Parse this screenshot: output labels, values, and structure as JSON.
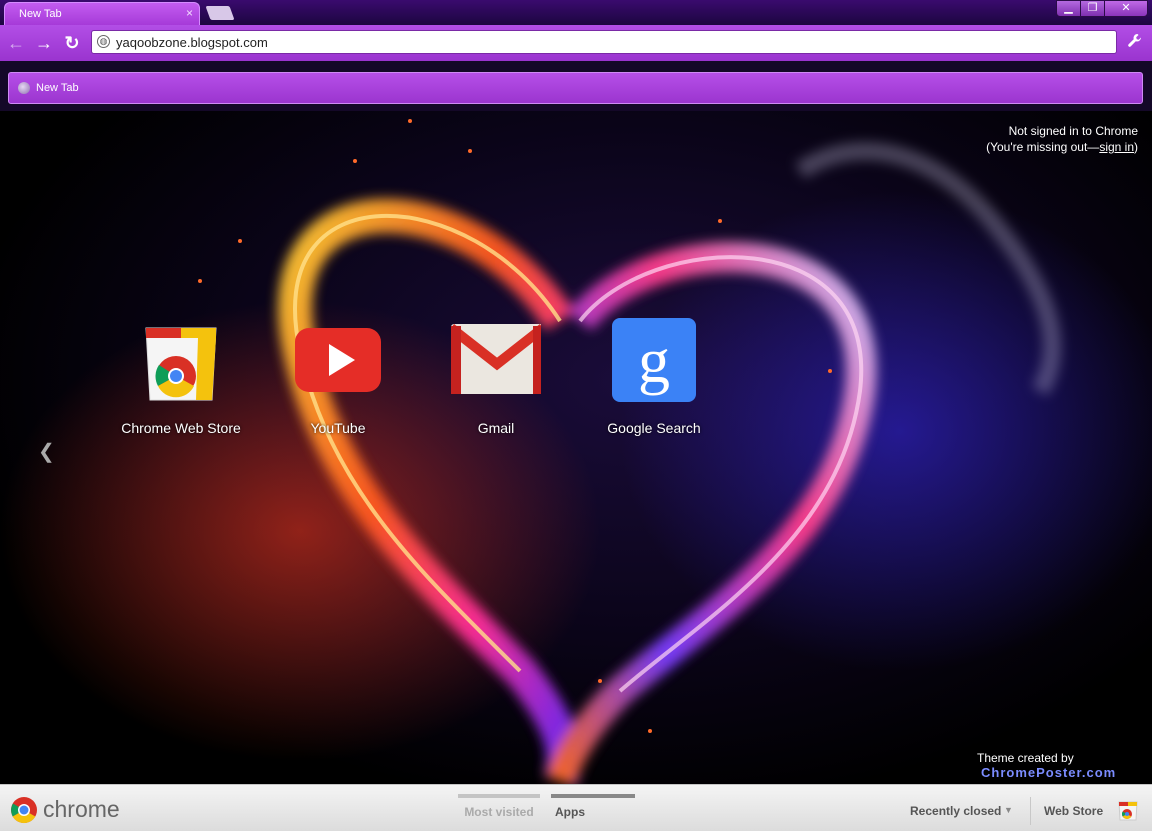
{
  "tabs": [
    {
      "title": "New Tab",
      "close_glyph": "×"
    }
  ],
  "window_controls": {
    "minimize": "▁",
    "maximize": "❐",
    "close": "✕"
  },
  "toolbar": {
    "back_glyph": "←",
    "forward_glyph": "→",
    "reload_glyph": "↻",
    "url": "yaqoobzone.blogspot.com",
    "wrench_glyph": "🔧"
  },
  "page_bar": {
    "title": "New Tab"
  },
  "signin": {
    "line1": "Not signed in to Chrome",
    "line2_prefix": "(You're missing out—",
    "link": "sign in",
    "line2_suffix": ")"
  },
  "apps": [
    {
      "label": "Chrome Web Store",
      "icon": "chrome-web-store-icon"
    },
    {
      "label": "YouTube",
      "icon": "youtube-icon"
    },
    {
      "label": "Gmail",
      "icon": "gmail-icon"
    },
    {
      "label": "Google Search",
      "icon": "google-search-icon"
    }
  ],
  "prev_page_glyph": "❮",
  "theme_credit": {
    "line1": "Theme created by",
    "site": "ChromePoster.com"
  },
  "footer": {
    "brand": "chrome",
    "tabs": [
      {
        "label": "Most visited"
      },
      {
        "label": "Apps"
      }
    ],
    "recently_closed": "Recently closed",
    "recently_closed_arrow": "▼",
    "web_store": "Web Store"
  },
  "colors": {
    "accent": "#a63ad8",
    "toolbar": "#b24ee6",
    "theme_site": "#7b8cff"
  }
}
